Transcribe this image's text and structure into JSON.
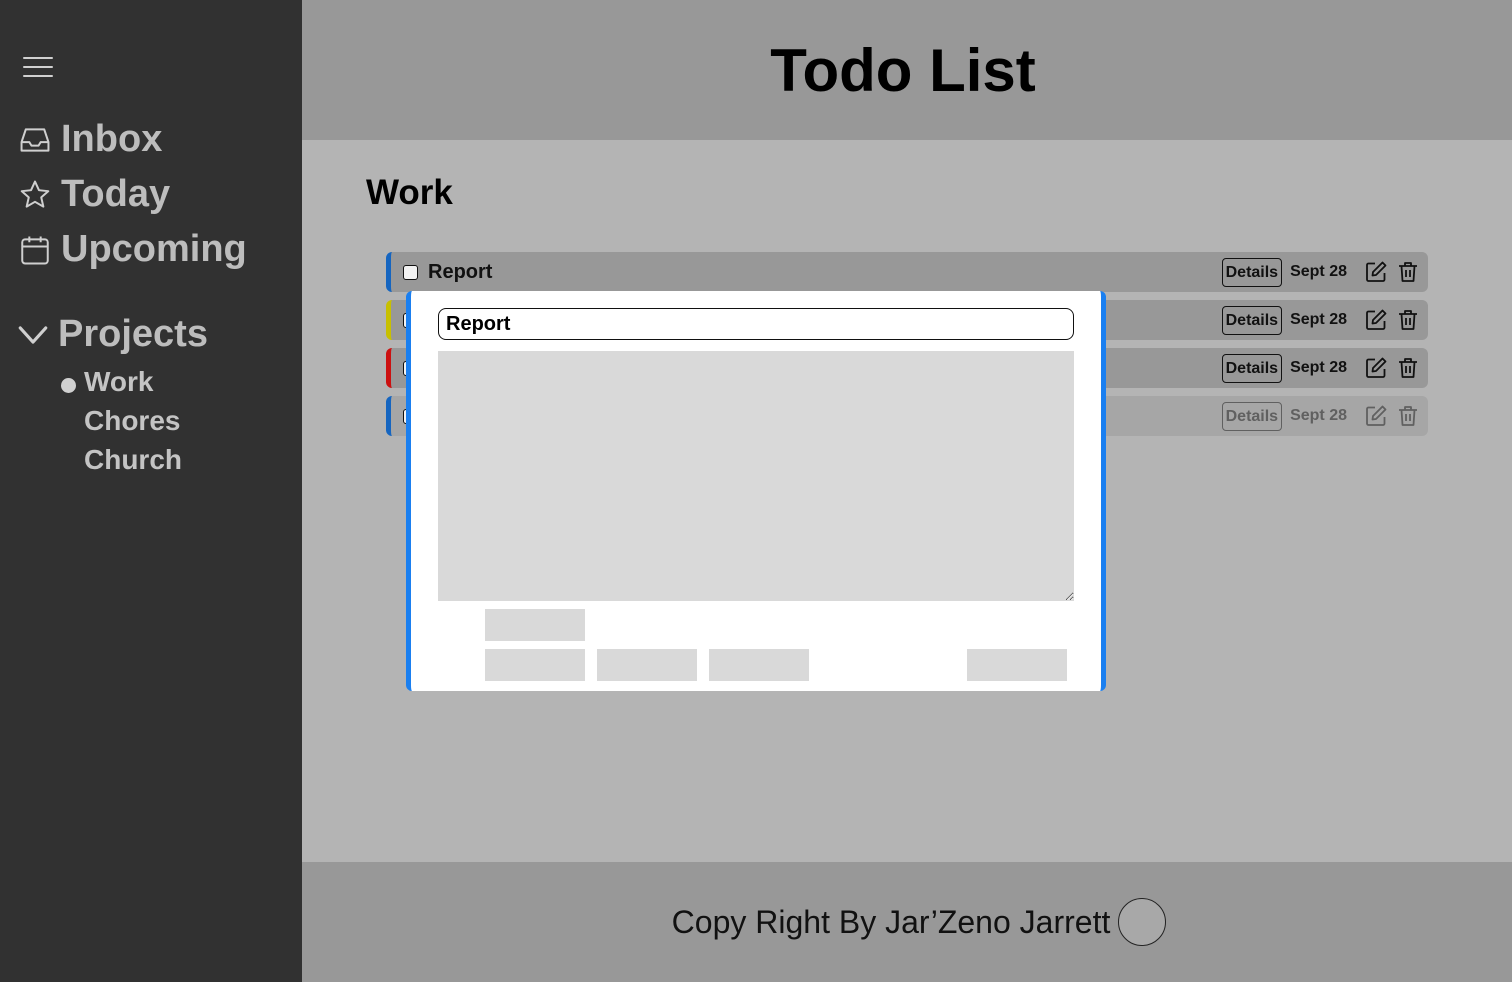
{
  "header": {
    "title": "Todo List"
  },
  "sidebar": {
    "nav": [
      {
        "label": "Inbox",
        "icon": "inbox-icon"
      },
      {
        "label": "Today",
        "icon": "star-icon"
      },
      {
        "label": "Upcoming",
        "icon": "calendar-icon"
      }
    ],
    "projects_label": "Projects",
    "projects": [
      {
        "label": "Work",
        "active": true
      },
      {
        "label": "Chores",
        "active": false
      },
      {
        "label": "Church",
        "active": false
      }
    ]
  },
  "main": {
    "section_title": "Work",
    "todos": [
      {
        "title": "Report",
        "details_label": "Details",
        "date": "Sept 28",
        "priority_color": "#1565c0",
        "done": false
      },
      {
        "title": "",
        "details_label": "Details",
        "date": "Sept 28",
        "priority_color": "#c8c000",
        "done": false
      },
      {
        "title": "",
        "details_label": "Details",
        "date": "Sept 28",
        "priority_color": "#cc1010",
        "done": false
      },
      {
        "title": "",
        "details_label": "Details",
        "date": "Sept 28",
        "priority_color": "#1565c0",
        "done": true
      }
    ]
  },
  "modal": {
    "title_value": "Report",
    "accent_color": "#1a7ff0"
  },
  "footer": {
    "text": "Copy Right By Jar’Zeno Jarrett"
  },
  "colors": {
    "sidebar_bg": "#313131",
    "header_bg": "#989898",
    "main_bg": "#b4b4b4"
  }
}
